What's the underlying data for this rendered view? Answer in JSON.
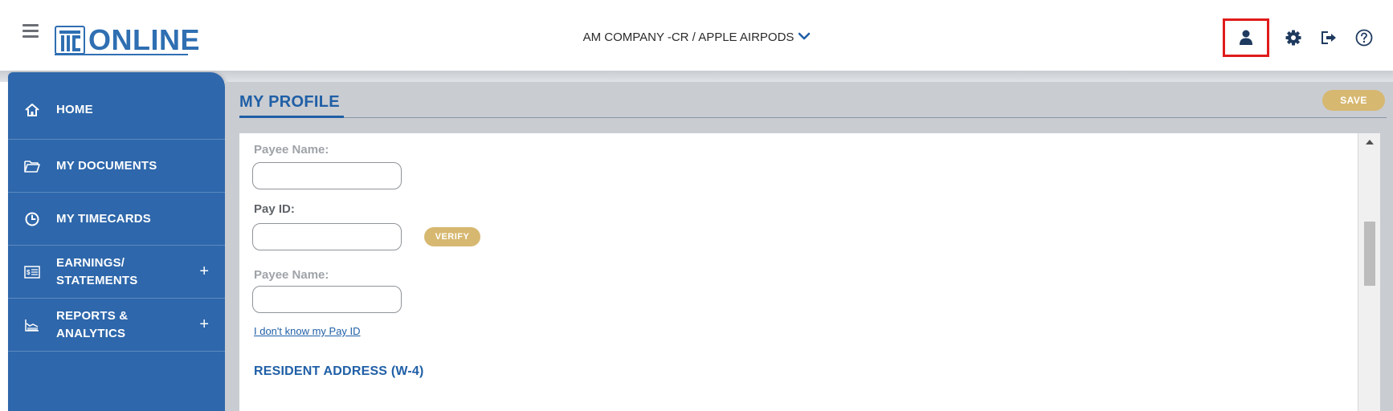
{
  "header": {
    "logo_text": "ONLINE",
    "company_selector": "AM COMPANY -CR / APPLE AIRPODS",
    "icons": [
      "user-icon",
      "gear-icon",
      "logout-icon",
      "help-icon"
    ]
  },
  "sidebar": {
    "items": [
      {
        "label_lines": [
          "HOME"
        ],
        "icon": "home-icon",
        "expandable": false
      },
      {
        "label_lines": [
          "MY DOCUMENTS"
        ],
        "icon": "folder-icon",
        "expandable": false
      },
      {
        "label_lines": [
          "MY TIMECARDS"
        ],
        "icon": "clock-icon",
        "expandable": false
      },
      {
        "label_lines": [
          "EARNINGS/",
          "STATEMENTS"
        ],
        "icon": "statement-icon",
        "expandable": true,
        "expand_symbol": "+"
      },
      {
        "label_lines": [
          "REPORTS &",
          "ANALYTICS"
        ],
        "icon": "chart-icon",
        "expandable": true,
        "expand_symbol": "+"
      }
    ]
  },
  "main": {
    "title": "MY PROFILE",
    "save_label": "SAVE",
    "form": {
      "payee_name_1_label": "Payee Name:",
      "payee_name_1_value": "",
      "pay_id_label": "Pay ID:",
      "pay_id_value": "",
      "verify_label": "VERIFY",
      "payee_name_2_label": "Payee Name:",
      "payee_name_2_value": "",
      "dont_know_link": "I don't know my Pay ID",
      "resident_address_title": "RESIDENT ADDRESS (W-4)"
    }
  },
  "colors": {
    "brand_blue": "#2e67ab",
    "accent_gold": "#d7b871",
    "highlight_red": "#e01b1b"
  }
}
